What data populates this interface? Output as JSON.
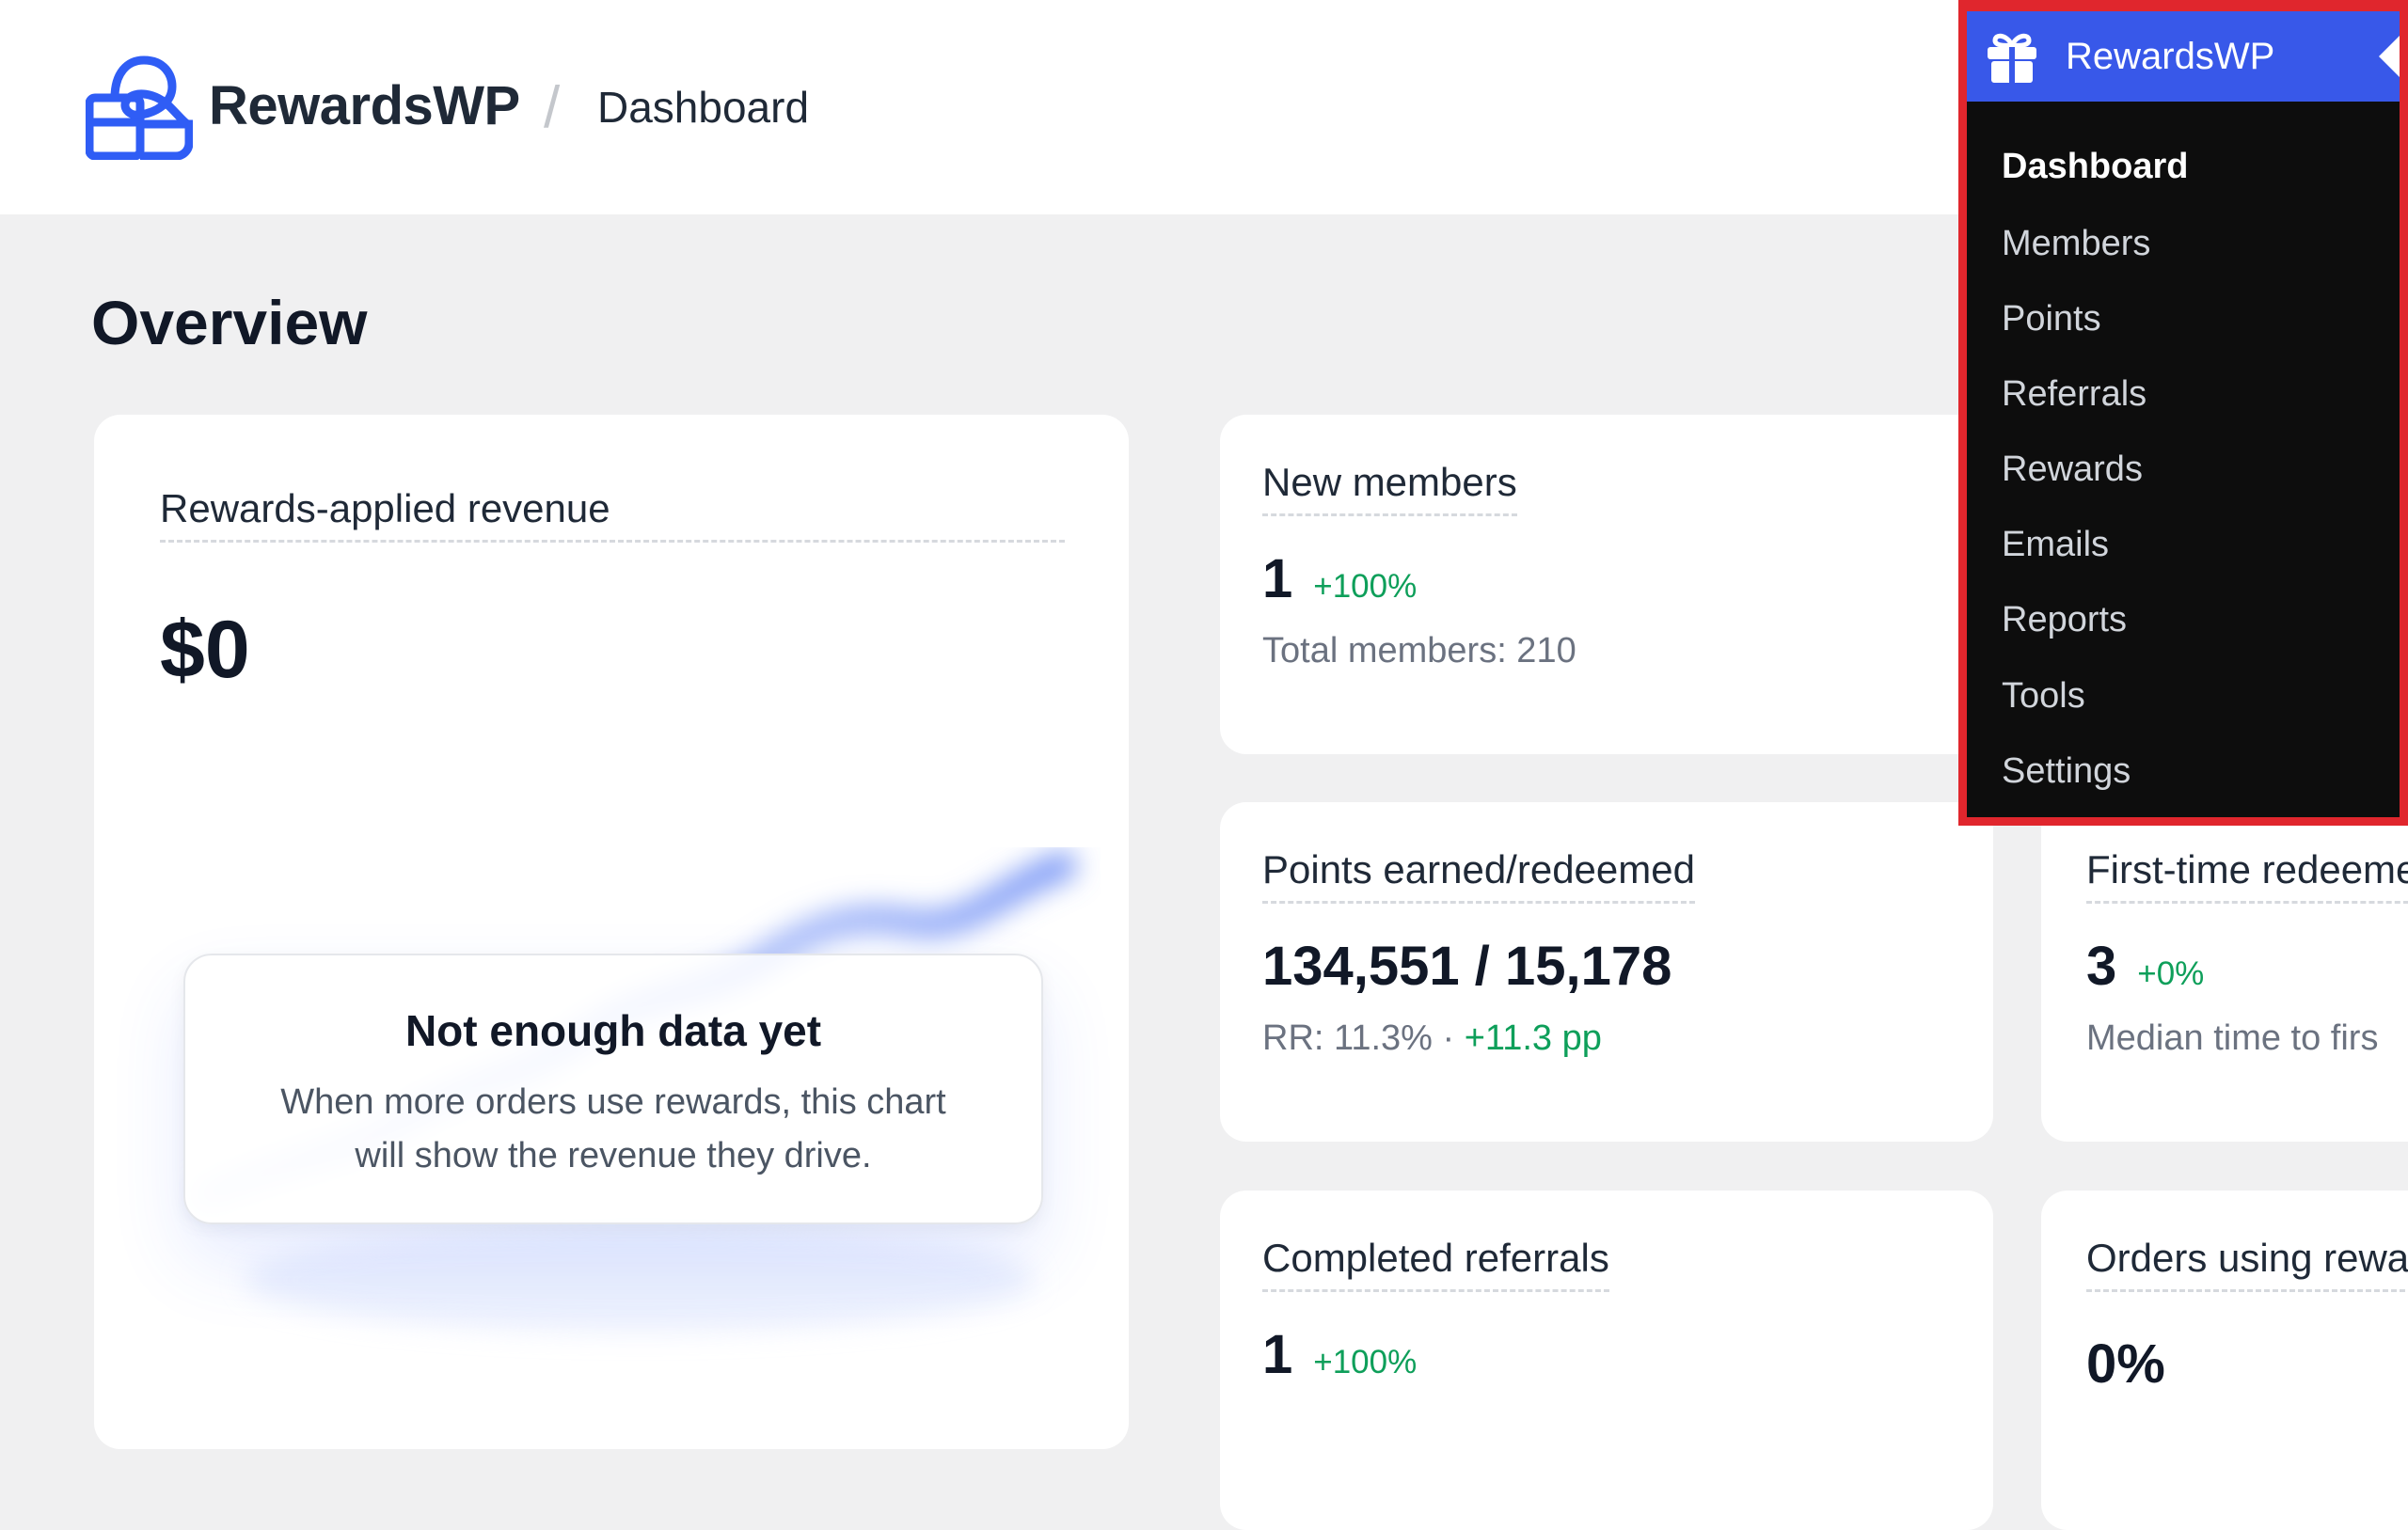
{
  "header": {
    "brand": "RewardsWP",
    "separator": "/",
    "breadcrumb": "Dashboard"
  },
  "page_title": "Overview",
  "revenue_card": {
    "title": "Rewards-applied revenue",
    "value": "$0",
    "empty_state": {
      "title": "Not enough data yet",
      "text": "When more orders use rewards, this chart will show the revenue they drive."
    }
  },
  "cards": {
    "new_members": {
      "title": "New members",
      "value": "1",
      "delta": "+100%",
      "sub": "Total members: 210"
    },
    "points": {
      "title": "Points earned/redeemed",
      "value": "134,551 / 15,178",
      "sub_prefix": "RR: 11.3% ·",
      "sub_delta": "+11.3 pp"
    },
    "first_time": {
      "title": "First-time redeeme",
      "value": "3",
      "delta": "+0%",
      "sub": "Median time to firs"
    },
    "completed_referrals": {
      "title": "Completed referrals",
      "value": "1",
      "delta": "+100%"
    },
    "orders_rewards": {
      "title": "Orders using rewar",
      "value": "0%"
    }
  },
  "admin_menu": {
    "title": "RewardsWP",
    "items": [
      {
        "label": "Dashboard",
        "current": true
      },
      {
        "label": "Members"
      },
      {
        "label": "Points"
      },
      {
        "label": "Referrals"
      },
      {
        "label": "Rewards"
      },
      {
        "label": "Emails"
      },
      {
        "label": "Reports"
      },
      {
        "label": "Tools"
      },
      {
        "label": "Settings"
      }
    ],
    "highlight_color": "#e0262d",
    "head_color": "#3858e9"
  },
  "colors": {
    "accent": "#2f5df5",
    "positive": "#0e9f5a",
    "background": "#f0f0f1"
  }
}
